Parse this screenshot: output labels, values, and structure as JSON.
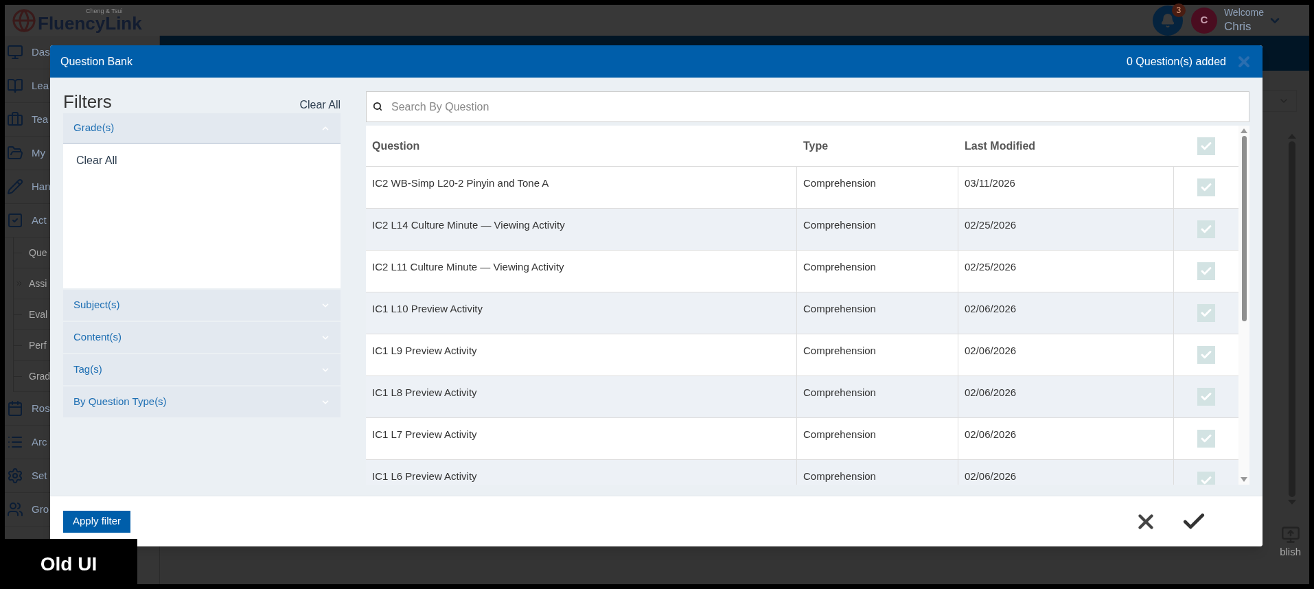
{
  "app": {
    "logo": {
      "tagline": "Cheng & Tsui",
      "name": "FluencyLink"
    },
    "notifications": {
      "count": "3"
    },
    "user": {
      "initial": "C",
      "greeting": "Welcome",
      "name": "Chris"
    }
  },
  "sidebar": {
    "items": [
      {
        "label": "Das",
        "kind": "main"
      },
      {
        "label": "Lea",
        "kind": "main"
      },
      {
        "label": "Tea",
        "kind": "main"
      },
      {
        "label": "My",
        "kind": "main"
      },
      {
        "label": "Han",
        "kind": "main"
      },
      {
        "label": "Act",
        "kind": "main"
      },
      {
        "label": "Que",
        "kind": "sub",
        "current": false
      },
      {
        "label": "Assi",
        "kind": "sub",
        "current": true
      },
      {
        "label": "Eval",
        "kind": "sub",
        "current": false
      },
      {
        "label": "Perf",
        "kind": "sub",
        "current": false
      },
      {
        "label": "Grad",
        "kind": "sub",
        "current": false
      },
      {
        "label": "Ros",
        "kind": "main"
      },
      {
        "label": "Arc",
        "kind": "main"
      },
      {
        "label": "Set",
        "kind": "main"
      },
      {
        "label": "Gro",
        "kind": "main"
      }
    ]
  },
  "background_page": {
    "publish_button": "blish"
  },
  "modal": {
    "title": "Question Bank",
    "added_count": "0 Question(s) added",
    "filters": {
      "heading": "Filters",
      "clear_all": "Clear All",
      "groups": [
        {
          "label": "Grade(s)",
          "expanded": true,
          "content": "Clear All"
        },
        {
          "label": "Subject(s)",
          "expanded": false
        },
        {
          "label": "Content(s)",
          "expanded": false
        },
        {
          "label": "Tag(s)",
          "expanded": false
        },
        {
          "label": "By Question Type(s)",
          "expanded": false
        }
      ],
      "apply_button": "Apply filter"
    },
    "search": {
      "placeholder": "Search By Question"
    },
    "table": {
      "columns": [
        "Question",
        "Type",
        "Last Modified"
      ],
      "select_all_checked": false,
      "rows": [
        {
          "question": "IC2 WB-Simp L20-2 Pinyin and Tone A",
          "type": "Comprehension",
          "last_modified": "03/11/2026",
          "checked": false
        },
        {
          "question": "IC2 L14 Culture Minute — Viewing Activity",
          "type": "Comprehension",
          "last_modified": "02/25/2026",
          "checked": false
        },
        {
          "question": "IC2 L11 Culture Minute — Viewing Activity",
          "type": "Comprehension",
          "last_modified": "02/25/2026",
          "checked": false
        },
        {
          "question": "IC1 L10 Preview Activity",
          "type": "Comprehension",
          "last_modified": "02/06/2026",
          "checked": false
        },
        {
          "question": "IC1 L9 Preview Activity",
          "type": "Comprehension",
          "last_modified": "02/06/2026",
          "checked": false
        },
        {
          "question": "IC1 L8 Preview Activity",
          "type": "Comprehension",
          "last_modified": "02/06/2026",
          "checked": false
        },
        {
          "question": "IC1 L7 Preview Activity",
          "type": "Comprehension",
          "last_modified": "02/06/2026",
          "checked": false
        },
        {
          "question": "IC1 L6 Preview Activity",
          "type": "Comprehension",
          "last_modified": "02/06/2026",
          "checked": false
        }
      ]
    }
  },
  "caption": "Old UI"
}
